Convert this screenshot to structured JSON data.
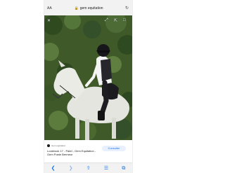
{
  "browser": {
    "aa_label": "AA",
    "url": "gem equitation",
    "icons": {
      "lock": "lock-icon",
      "reload": "reload-icon",
      "back": "back-icon",
      "forward": "forward-icon",
      "share": "share-icon",
      "bookmarks": "bookmarks-icon",
      "tabs": "tabs-icon"
    }
  },
  "viewer": {
    "icons": [
      "close-icon",
      "expand-icon",
      "share-icon",
      "bookmark-icon"
    ]
  },
  "result": {
    "source_name": "Gem equitation",
    "title": "Lookbook 17 - Patel - Gem Equitation - Gem Poste Bermeur",
    "visit_label": "Consulter"
  },
  "colors": {
    "accent": "#1a73e8",
    "foliage": "#3f5a28"
  }
}
